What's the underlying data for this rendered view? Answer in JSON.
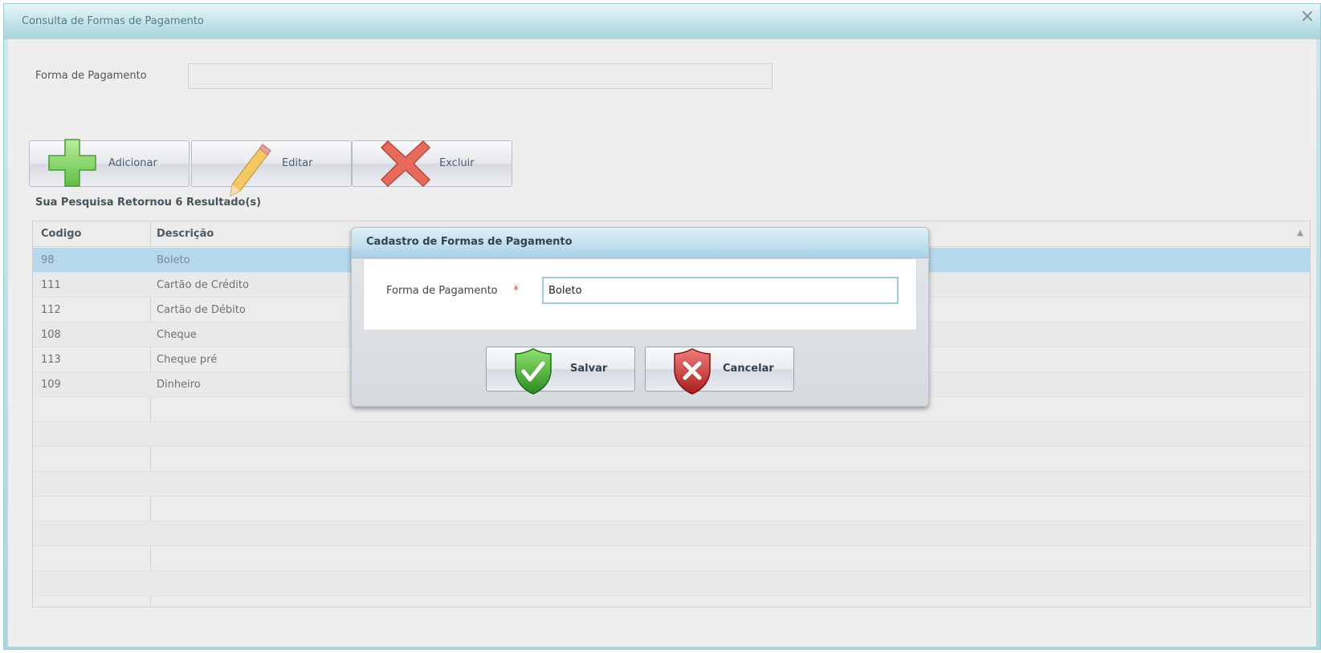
{
  "window": {
    "title": "Consulta de Formas de Pagamento",
    "close_symbol": "×"
  },
  "filter": {
    "label": "Forma de Pagamento",
    "value": ""
  },
  "toolbar": {
    "add_label": "Adicionar",
    "edit_label": "Editar",
    "delete_label": "Excluir",
    "add_icon": "plus-icon",
    "edit_icon": "pencil-icon",
    "delete_icon": "x-icon"
  },
  "results_text": "Sua Pesquisa Retornou 6 Resultado(s)",
  "grid": {
    "columns": [
      "Codigo",
      "Descrição"
    ],
    "sort_indicator": "▲",
    "rows": [
      {
        "codigo": "98",
        "descricao": "Boleto"
      },
      {
        "codigo": "111",
        "descricao": "Cartão de Crédito"
      },
      {
        "codigo": "112",
        "descricao": "Cartão de Débito"
      },
      {
        "codigo": "108",
        "descricao": "Cheque"
      },
      {
        "codigo": "113",
        "descricao": "Cheque pré"
      },
      {
        "codigo": "109",
        "descricao": "Dinheiro"
      }
    ],
    "selected_index": 0
  },
  "modal": {
    "title": "Cadastro de Formas de Pagamento",
    "field_label": "Forma de Pagamento",
    "required_marker": "*",
    "field_value": "Boleto",
    "save_label": "Salvar",
    "cancel_label": "Cancelar"
  },
  "colors": {
    "selected_row": "#b5d8ec",
    "accent": "#a9d6dd",
    "required": "#d64a4a"
  }
}
